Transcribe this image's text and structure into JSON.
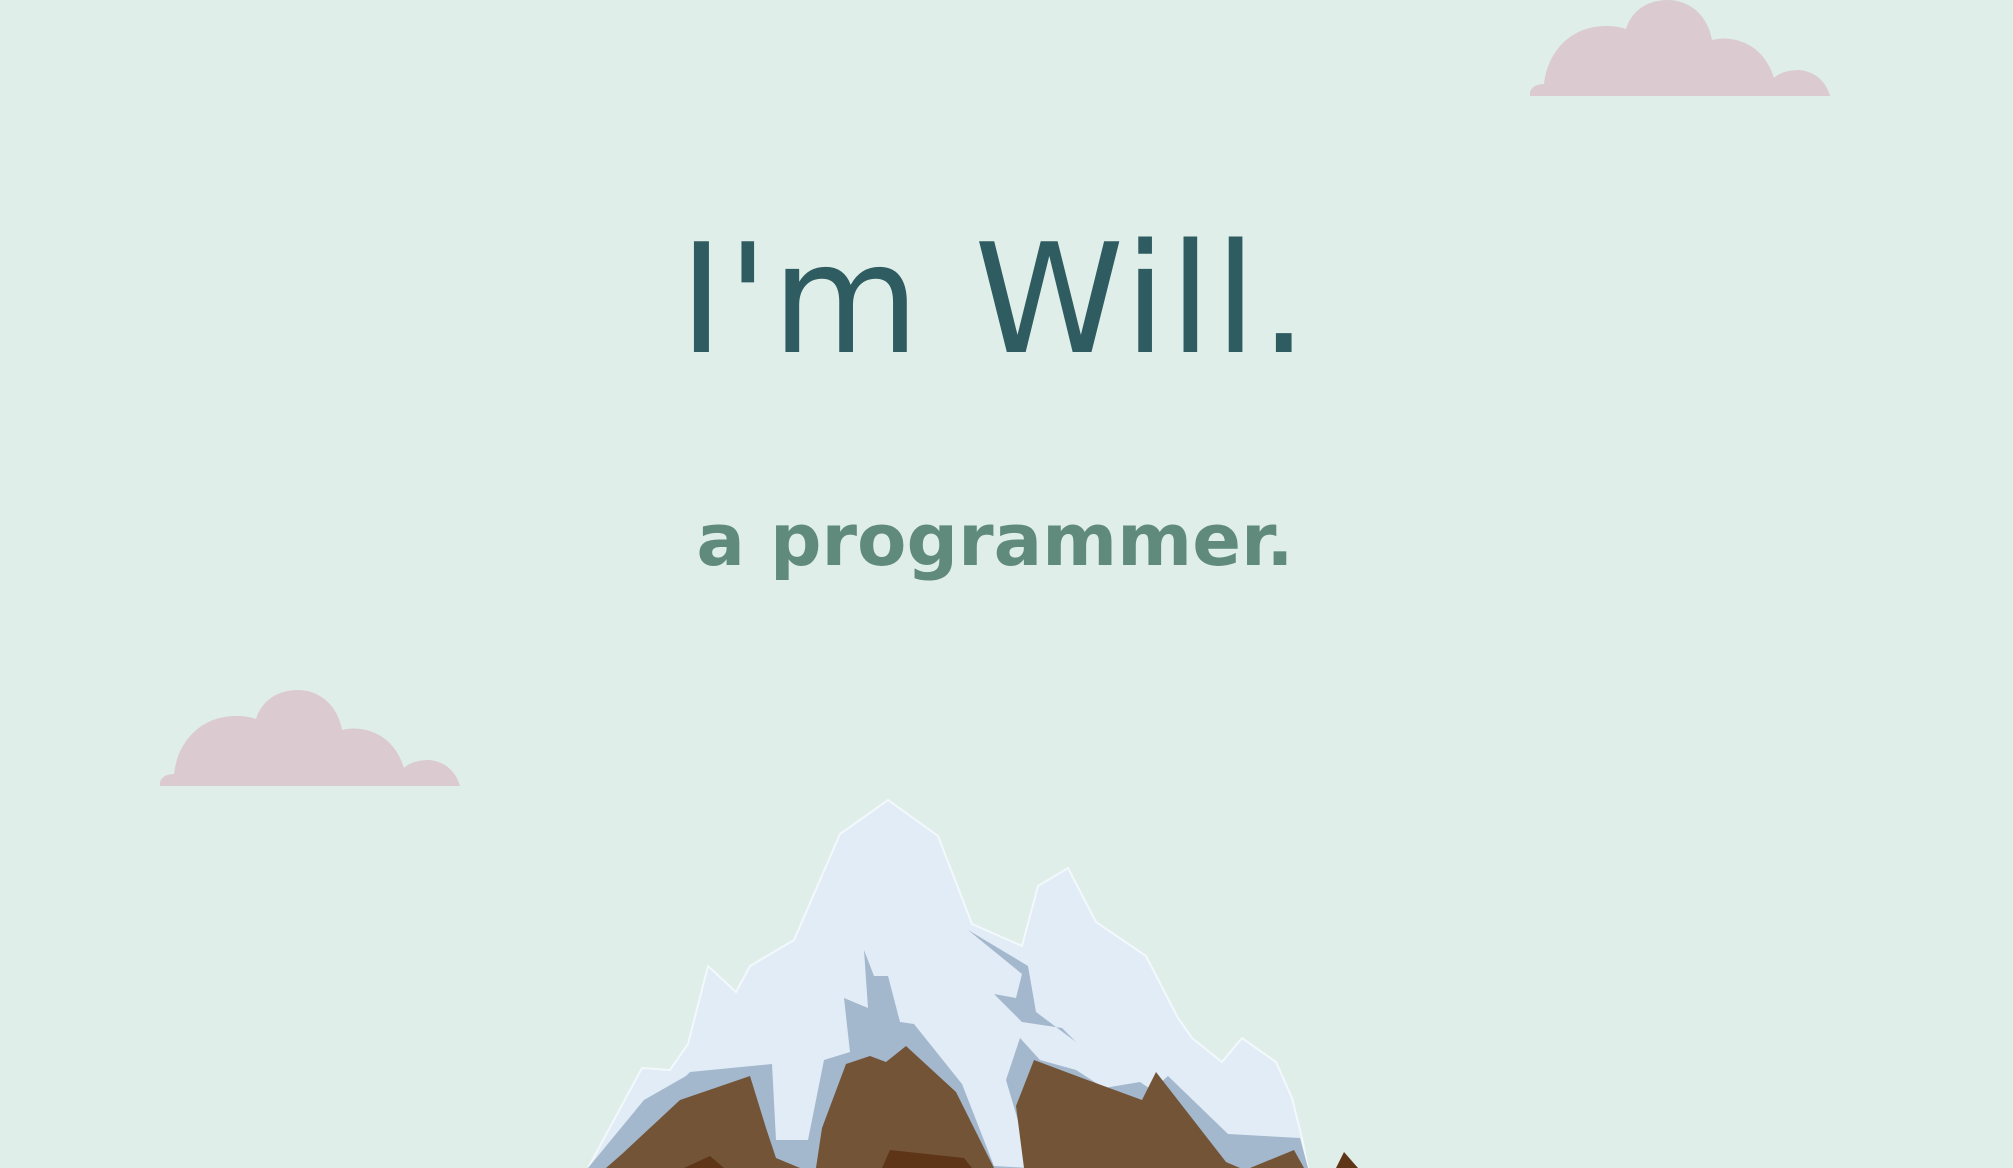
{
  "hero": {
    "title": "I'm Will.",
    "subtitle": "a programmer."
  },
  "decorations": {
    "clouds": [
      "cloud-icon",
      "cloud-icon"
    ],
    "mountain": "mountain-icon"
  },
  "colors": {
    "background": "#dfeee8",
    "title": "#2f5c61",
    "subtitle": "#5f8a7c",
    "cloud": "#dbcbd0",
    "snow": "#e2ecf6",
    "snow_shadow": "#a3b7cd",
    "rock": "#735437",
    "rock_dark": "#5e3617"
  }
}
